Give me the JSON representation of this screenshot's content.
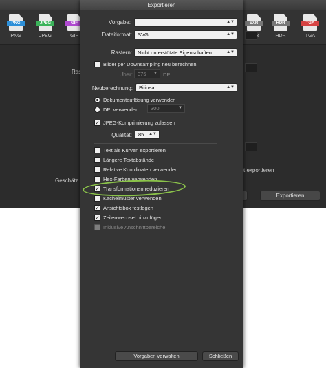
{
  "window_title": "Exportieren",
  "formats": [
    {
      "label": "PNG",
      "color": "#2d8fd8"
    },
    {
      "label": "JPEG",
      "color": "#3bb35a"
    },
    {
      "label": "GIF",
      "color": "#b04bd1"
    },
    {
      "label": "EXR",
      "color": "#777777"
    },
    {
      "label": "HDR",
      "color": "#777777"
    },
    {
      "label": "TGA",
      "color": "#d64343"
    }
  ],
  "background": {
    "ras_label": "Ras",
    "gesch_label": "Geschätz",
    "export_check_label": "t exportieren",
    "export_button": "Exportieren",
    "partial_button": "r"
  },
  "dialog": {
    "title": "Exportieren",
    "vorgabe_label": "Vorgabe:",
    "vorgabe_value": "",
    "dateiformat_label": "Dateiformat:",
    "dateiformat_value": "SVG",
    "rastern_label": "Rastern:",
    "rastern_value": "Nicht unterstützte Eigenschaften",
    "downsampling_label": "Bilder per Downsampling neu berechnen",
    "ueber_label": "Über:",
    "ueber_value": "375",
    "dpi_unit": "DPI",
    "neuberechnung_label": "Neuberechnung:",
    "neuberechnung_value": "Bilinear",
    "dokument_radio_label": "Dokumentauflösung verwenden",
    "dpi_radio_label": "DPI verwenden:",
    "dpi_radio_value": "300",
    "jpeg_label": "JPEG-Komprimierung zulassen",
    "qualitaet_label": "Qualität:",
    "qualitaet_value": "85",
    "options": [
      {
        "label": "Text als Kurven exportieren",
        "checked": false,
        "enabled": true
      },
      {
        "label": "Längere Textabstände",
        "checked": false,
        "enabled": true
      },
      {
        "label": "Relative Koordinaten verwenden",
        "checked": false,
        "enabled": true
      },
      {
        "label": "Hex-Farben verwenden",
        "checked": false,
        "enabled": true
      },
      {
        "label": "Transformationen reduzieren",
        "checked": true,
        "enabled": true
      },
      {
        "label": "Kachelmuster verwenden",
        "checked": false,
        "enabled": true
      },
      {
        "label": "Ansichtsbox festlegen",
        "checked": true,
        "enabled": true
      },
      {
        "label": "Zeilenwechsel hinzufügen",
        "checked": true,
        "enabled": true
      },
      {
        "label": "Inklusive Anschnittbereiche",
        "checked": false,
        "enabled": false
      }
    ],
    "manage_presets_button": "Vorgaben verwalten",
    "close_button": "Schließen",
    "check_mark": "✓",
    "dropdown_arrow": "▲▼",
    "highlight_color": "#8bc34a"
  }
}
